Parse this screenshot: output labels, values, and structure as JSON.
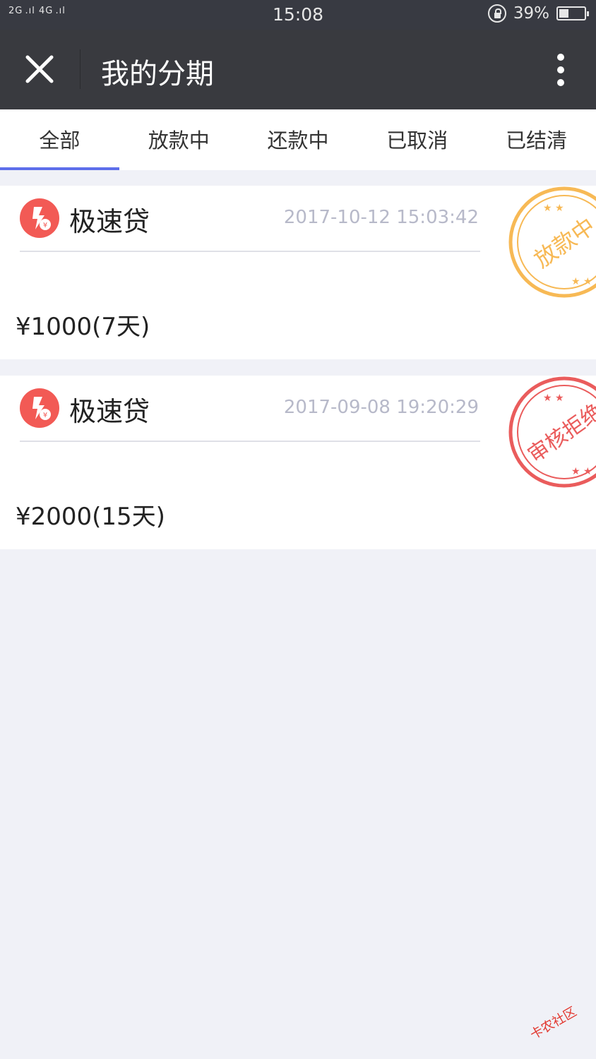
{
  "status_bar": {
    "signal": "2G .ıl  4G .ıl",
    "time": "15:08",
    "battery": "39%",
    "battery_level": 0.39
  },
  "nav": {
    "title": "我的分期"
  },
  "tabs": [
    {
      "label": "全部",
      "active": true
    },
    {
      "label": "放款中",
      "active": false
    },
    {
      "label": "还款中",
      "active": false
    },
    {
      "label": "已取消",
      "active": false
    },
    {
      "label": "已结清",
      "active": false
    }
  ],
  "loans": [
    {
      "product": "极速贷",
      "time": "2017-10-12 15:03:42",
      "amount": "¥1000(7天)",
      "stamp": "放款中",
      "stamp_color": "#f7b955"
    },
    {
      "product": "极速贷",
      "time": "2017-09-08 19:20:29",
      "amount": "¥2000(15天)",
      "stamp": "审核拒绝",
      "stamp_color": "#ea5c5c"
    }
  ],
  "colors": {
    "accent": "#5d6eea",
    "icon_red": "#f25a55",
    "nav_bg": "#393a3f",
    "page_bg": "#f0f1f7"
  },
  "watermark": "卡农社区"
}
